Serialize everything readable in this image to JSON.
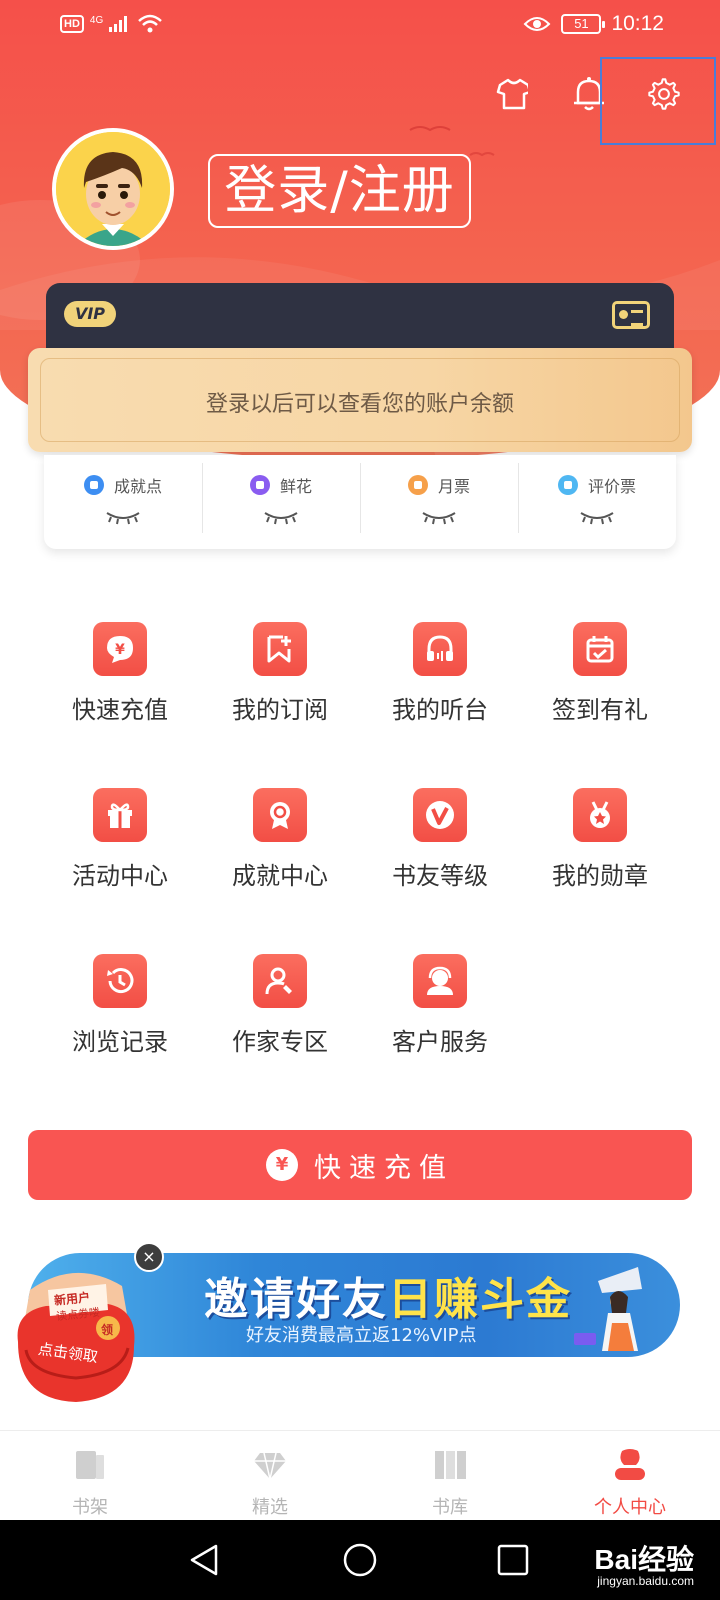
{
  "status_bar": {
    "network_badge": "HD",
    "network_type": "4G",
    "battery_level": "51",
    "time": "10:12"
  },
  "header": {
    "login_label": "登录/注册"
  },
  "vip_card": {
    "badge": "VIP",
    "balance_hint": "登录以后可以查看您的账户余额"
  },
  "stats": [
    {
      "label": "成就点",
      "color": "#3d8ef2"
    },
    {
      "label": "鲜花",
      "color": "#8a5cf0"
    },
    {
      "label": "月票",
      "color": "#f6a04a"
    },
    {
      "label": "评价票",
      "color": "#4fb7f2"
    }
  ],
  "grid": [
    {
      "label": "快速充值",
      "icon": "yen-icon"
    },
    {
      "label": "我的订阅",
      "icon": "bookmark-plus-icon"
    },
    {
      "label": "我的听台",
      "icon": "headphones-icon"
    },
    {
      "label": "签到有礼",
      "icon": "calendar-check-icon"
    },
    {
      "label": "活动中心",
      "icon": "gift-icon"
    },
    {
      "label": "成就中心",
      "icon": "medal-icon"
    },
    {
      "label": "书友等级",
      "icon": "v-level-icon"
    },
    {
      "label": "我的勋章",
      "icon": "badge-star-icon"
    },
    {
      "label": "浏览记录",
      "icon": "history-icon"
    },
    {
      "label": "作家专区",
      "icon": "writer-icon"
    },
    {
      "label": "客户服务",
      "icon": "customer-service-icon"
    }
  ],
  "recharge_button": {
    "label": "快速充值",
    "icon_glyph": "¥"
  },
  "banner": {
    "title_part1": "邀请好友",
    "title_part2": "日赚斗金",
    "subtitle": "好友消费最高立返12%VIP点",
    "close_glyph": "×",
    "redpack_top": "新用户",
    "redpack_mid": "读点券喽",
    "redpack_btn": "点击领取",
    "redpack_coin": "领"
  },
  "tabs": [
    {
      "label": "书架",
      "active": false
    },
    {
      "label": "精选",
      "active": false
    },
    {
      "label": "书库",
      "active": false
    },
    {
      "label": "个人中心",
      "active": true
    }
  ],
  "watermark": {
    "brand": "Bai经验",
    "url": "jingyan.baidu.com"
  },
  "colors": {
    "brand_red": "#f95552",
    "header_red": "#f5504a",
    "vip_dark": "#2f3242",
    "vip_gold": "#f1d37a",
    "banner_blue": "#2f86d8"
  }
}
